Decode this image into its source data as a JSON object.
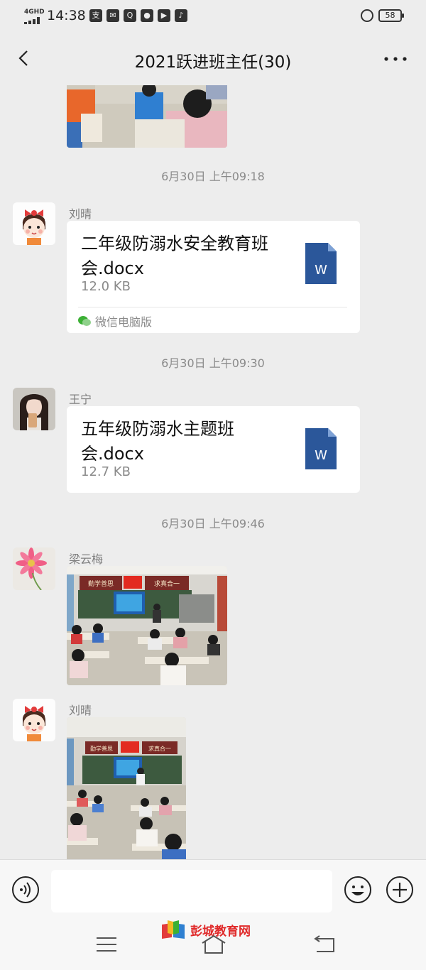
{
  "status_bar": {
    "network": "4GHD",
    "time": "14:38",
    "battery": "58",
    "app_icons": [
      "pay-icon",
      "mail-icon",
      "qq-icon",
      "location-icon",
      "video-icon",
      "tiktok-icon"
    ]
  },
  "nav": {
    "title": "2021跃进班主任(30)"
  },
  "messages": {
    "ts1": "6月30日 上午09:18",
    "msg1": {
      "sender": "刘晴",
      "file_name": "二年级防溺水安全教育班会.docx",
      "file_size": "12.0 KB",
      "file_icon_letter": "W",
      "source": "微信电脑版"
    },
    "ts2": "6月30日 上午09:30",
    "msg2": {
      "sender": "王宁",
      "file_name": "五年级防溺水主题班会.docx",
      "file_size": "12.7 KB",
      "file_icon_letter": "W"
    },
    "ts3": "6月30日 上午09:46",
    "msg3": {
      "sender": "梁云梅",
      "banner_left": "勤学善思",
      "banner_right": "求真合一"
    },
    "msg4": {
      "sender": "刘晴",
      "banner_left": "勤学善思",
      "banner_right": "求真合一"
    }
  },
  "watermark": {
    "text": "彭城教育网"
  },
  "colors": {
    "background": "#ededed",
    "bubble": "#ffffff",
    "word_blue": "#2b579a",
    "watermark_red": "#e02a2a"
  }
}
